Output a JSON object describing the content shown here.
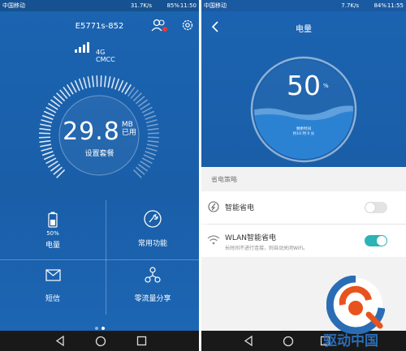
{
  "left_screen": {
    "status_bar": {
      "carrier": "中国移动",
      "speed": "31.7K/s",
      "battery": "85%",
      "time": "11:50"
    },
    "device_name": "E5771s-852",
    "network": {
      "generation": "4G",
      "operator": "CMCC"
    },
    "data_usage": {
      "value": "29.8",
      "unit": "MB",
      "unit_label": "已用",
      "subtitle": "设置套餐"
    },
    "tiles": [
      {
        "label": "电量",
        "value": "50%",
        "icon": "battery-icon"
      },
      {
        "label": "常用功能",
        "icon": "tools-icon"
      },
      {
        "label": "短信",
        "icon": "mail-icon"
      },
      {
        "label": "零流量分享",
        "icon": "share-icon"
      }
    ],
    "page_count": 2,
    "current_page": 2
  },
  "right_screen": {
    "status_bar": {
      "carrier": "中国移动",
      "speed": "7.7K/s",
      "battery": "84%",
      "time": "11:55"
    },
    "title": "电量",
    "battery_percent": "50",
    "percent_symbol": "%",
    "remain_label": "剩余时间",
    "remain_time": "约10 时 0 分",
    "section_label": "省电策略",
    "settings": [
      {
        "title": "智能省电",
        "subtitle": "",
        "enabled": false,
        "icon": "smart-saver-icon"
      },
      {
        "title": "WLAN智能省电",
        "subtitle": "长时间不进行连接，则自动关闭WiFi。",
        "enabled": true,
        "icon": "wifi-icon"
      }
    ]
  },
  "watermark": {
    "text": "驱动中国"
  },
  "colors": {
    "blue": "#1a5ea8",
    "teal": "#2bb3b6",
    "nav": "#191919",
    "logo_orange": "#e8531d",
    "logo_blue": "#2a6db5"
  }
}
